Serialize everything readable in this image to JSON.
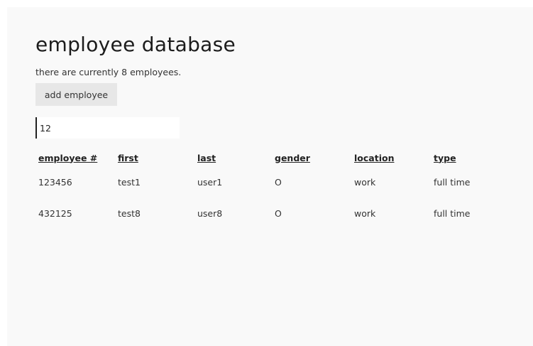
{
  "page": {
    "title": "employee database",
    "employee_count_text": "there are currently 8 employees.",
    "add_button_label": "add employee"
  },
  "search": {
    "value": "12",
    "placeholder": ""
  },
  "table": {
    "headers": {
      "id": "employee #",
      "first": "first",
      "last": "last",
      "gender": "gender",
      "location": "location",
      "type": "type"
    },
    "rows": [
      {
        "id": "123456",
        "first": "test1",
        "last": "user1",
        "gender": "O",
        "location": "work",
        "type": "full time"
      },
      {
        "id": "432125",
        "first": "test8",
        "last": "user8",
        "gender": "O",
        "location": "work",
        "type": "full time"
      }
    ]
  }
}
